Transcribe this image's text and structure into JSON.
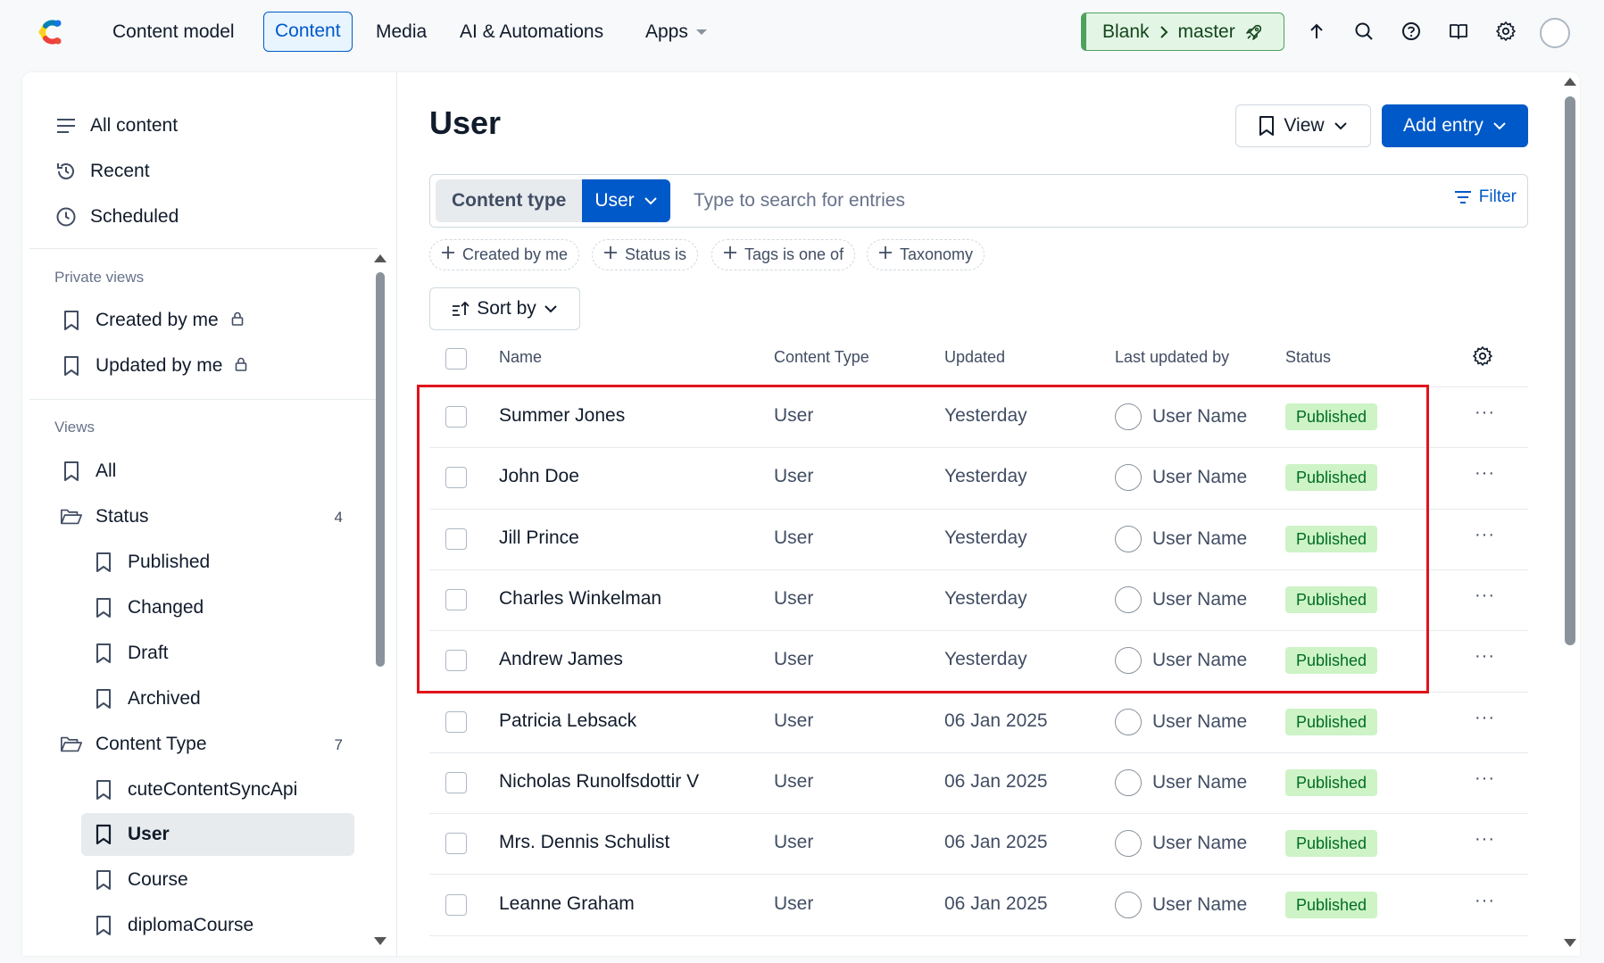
{
  "nav": {
    "items": [
      "Content model",
      "Content",
      "Media",
      "AI & Automations",
      "Apps"
    ],
    "active": "Content",
    "env_space": "Blank",
    "env_branch": "master"
  },
  "sidebar": {
    "top": [
      "All content",
      "Recent",
      "Scheduled"
    ],
    "private_title": "Private views",
    "private": [
      "Created by me",
      "Updated by me"
    ],
    "views_title": "Views",
    "views_all": "All",
    "status_folder": "Status",
    "status_count": "4",
    "status_items": [
      "Published",
      "Changed",
      "Draft",
      "Archived"
    ],
    "ct_folder": "Content Type",
    "ct_count": "7",
    "ct_items": [
      "cuteContentSyncApi",
      "User",
      "Course",
      "diplomaCourse"
    ],
    "active_item": "User"
  },
  "main": {
    "title": "User",
    "view_label": "View",
    "add_label": "Add entry",
    "content_type_label": "Content type",
    "content_type_value": "User",
    "search_placeholder": "Type to search for entries",
    "filter_label": "Filter",
    "chips": [
      "Created by me",
      "Status is",
      "Tags is one of",
      "Taxonomy"
    ],
    "sort_label": "Sort by"
  },
  "table": {
    "headers": [
      "Name",
      "Content Type",
      "Updated",
      "Last updated by",
      "Status"
    ],
    "rows": [
      {
        "name": "Summer Jones",
        "type": "User",
        "updated": "Yesterday",
        "by": "User Name",
        "status": "Published"
      },
      {
        "name": "John Doe",
        "type": "User",
        "updated": "Yesterday",
        "by": "User Name",
        "status": "Published"
      },
      {
        "name": "Jill Prince",
        "type": "User",
        "updated": "Yesterday",
        "by": "User Name",
        "status": "Published"
      },
      {
        "name": "Charles Winkelman",
        "type": "User",
        "updated": "Yesterday",
        "by": "User Name",
        "status": "Published"
      },
      {
        "name": "Andrew James",
        "type": "User",
        "updated": "Yesterday",
        "by": "User Name",
        "status": "Published"
      },
      {
        "name": "Patricia Lebsack",
        "type": "User",
        "updated": "06 Jan 2025",
        "by": "User Name",
        "status": "Published"
      },
      {
        "name": "Nicholas Runolfsdottir V",
        "type": "User",
        "updated": "06 Jan 2025",
        "by": "User Name",
        "status": "Published"
      },
      {
        "name": "Mrs. Dennis Schulist",
        "type": "User",
        "updated": "06 Jan 2025",
        "by": "User Name",
        "status": "Published"
      },
      {
        "name": "Leanne Graham",
        "type": "User",
        "updated": "06 Jan 2025",
        "by": "User Name",
        "status": "Published"
      }
    ]
  },
  "colors": {
    "primary": "#0059c8",
    "published_bg": "#cdf3c6",
    "published_text": "#006d23",
    "highlight": "#e0141b",
    "env_green": "#52a05d"
  },
  "icons": [
    "contentful-logo",
    "upload-icon",
    "search-icon",
    "help-icon",
    "book-icon",
    "gear-icon",
    "rocket-icon"
  ]
}
